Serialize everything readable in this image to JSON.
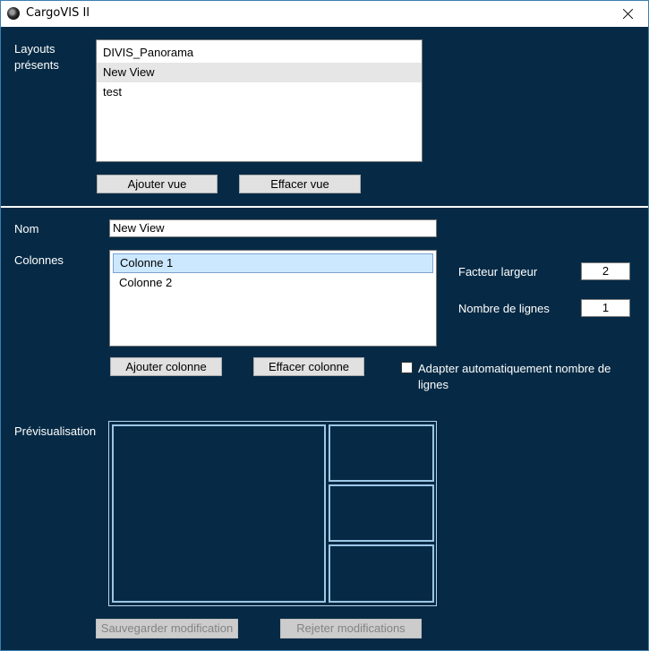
{
  "window": {
    "title": "CargoVIS II",
    "icon": "app-logo-icon",
    "close_icon": "close-icon"
  },
  "layouts": {
    "label": "Layouts\nprésents",
    "items": [
      "DIVIS_Panorama",
      "New View",
      "test"
    ],
    "highlighted": "New View",
    "add_button": "Ajouter vue",
    "delete_button": "Effacer vue"
  },
  "form": {
    "name_label": "Nom",
    "name_value": "New View",
    "columns_label": "Colonnes",
    "columns": [
      "Colonne 1",
      "Colonne 2"
    ],
    "selected_column": "Colonne 1",
    "add_column_button": "Ajouter colonne",
    "delete_column_button": "Effacer colonne",
    "width_factor_label": "Facteur largeur",
    "width_factor_value": "2",
    "rows_label": "Nombre de lignes",
    "rows_value": "1",
    "auto_rows_label": "Adapter automatiquement nombre de\nlignes",
    "auto_rows_checked": false
  },
  "preview": {
    "label": "Prévisualisation"
  },
  "footer": {
    "save_button": "Sauvegarder modification",
    "reject_button": "Rejeter modifications"
  },
  "colors": {
    "background": "#062a45",
    "preview_border": "#9dc6e6",
    "selection": "#cce8ff"
  }
}
